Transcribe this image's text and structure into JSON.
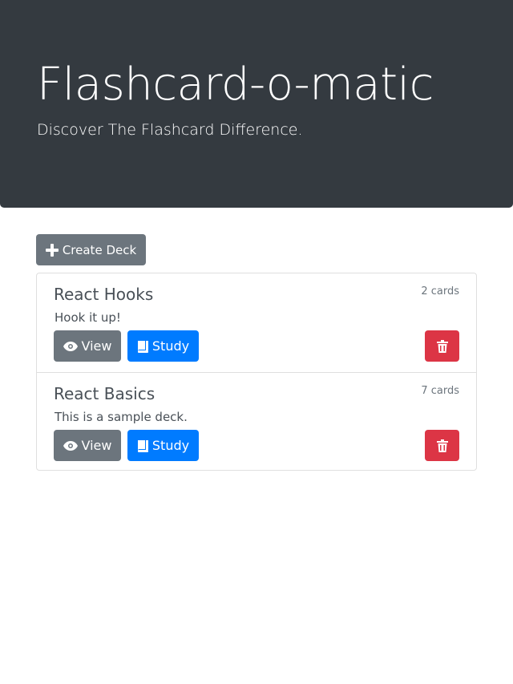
{
  "header": {
    "title": "Flashcard-o-matic",
    "subtitle": "Discover The Flashcard Difference."
  },
  "toolbar": {
    "create_label": "Create Deck"
  },
  "decks": [
    {
      "name": "React Hooks",
      "count": "2 cards",
      "description": "Hook it up!",
      "view_label": "View",
      "study_label": "Study"
    },
    {
      "name": "React Basics",
      "count": "7 cards",
      "description": "This is a sample deck.",
      "view_label": "View",
      "study_label": "Study"
    }
  ],
  "icons": {
    "create": "plus-icon",
    "view": "eye-icon",
    "study": "book-icon",
    "delete": "trash-icon"
  },
  "colors": {
    "header_bg": "#343a40",
    "secondary": "#6c757d",
    "primary": "#007bff",
    "danger": "#dc3545"
  }
}
